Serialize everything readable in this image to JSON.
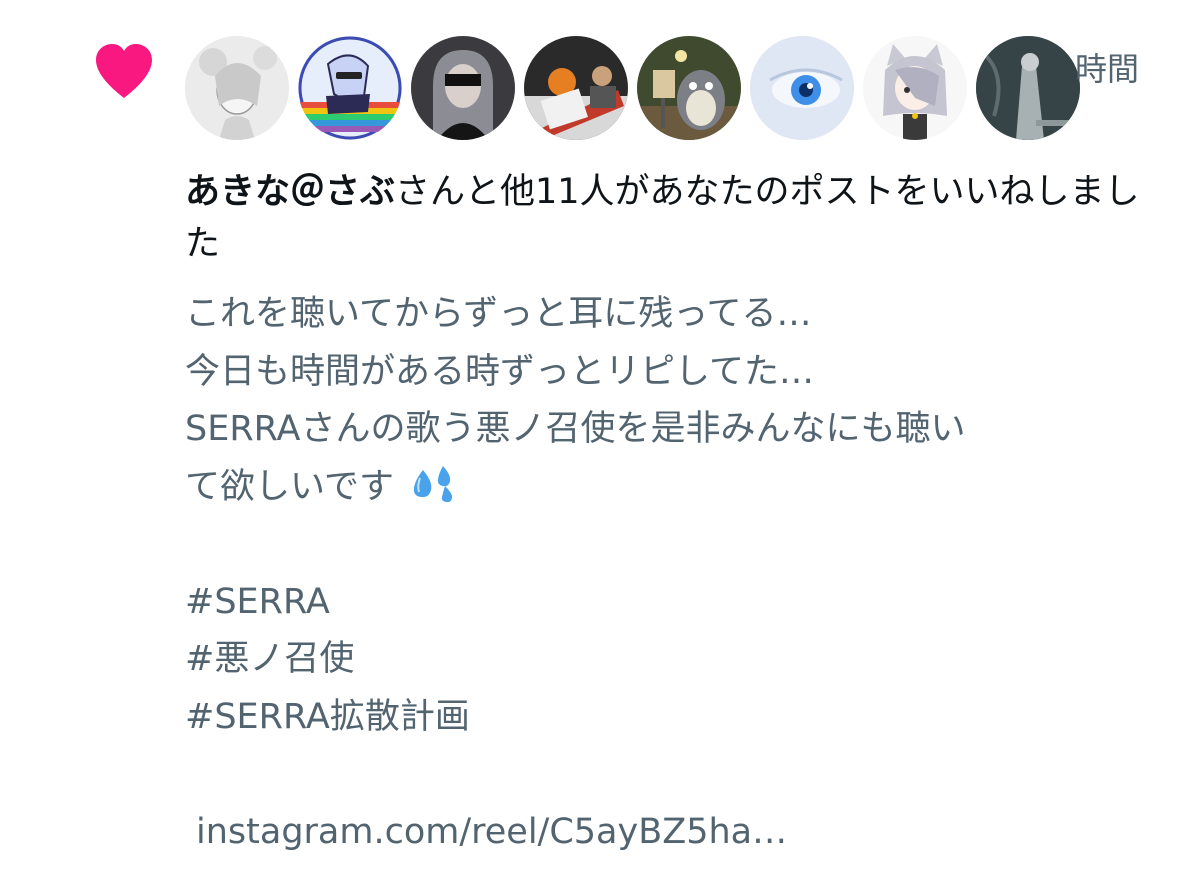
{
  "notification": {
    "time": "時間",
    "summary": {
      "name": "あきな＠さぶ",
      "rest": "さんと他11人があなたのポストをいいねしました"
    },
    "post_lines": [
      "これを聴いてからずっと耳に残ってる…",
      "今日も時間がある時ずっとリピしてた…",
      "SERRAさんの歌う悪ノ召使を是非みんなにも聴い",
      "て欲しいです"
    ],
    "hashtags": [
      "#SERRA",
      "#悪ノ召使",
      "#SERRA拡散計画"
    ],
    "link": "instagram.com/reel/C5ayBZ5ha…",
    "colors": {
      "heart": "#f91880",
      "primary_text": "#0f1419",
      "secondary_text": "#536471"
    },
    "icons": {
      "like": "heart-icon",
      "emoji": "sweat-droplets-icon"
    }
  }
}
